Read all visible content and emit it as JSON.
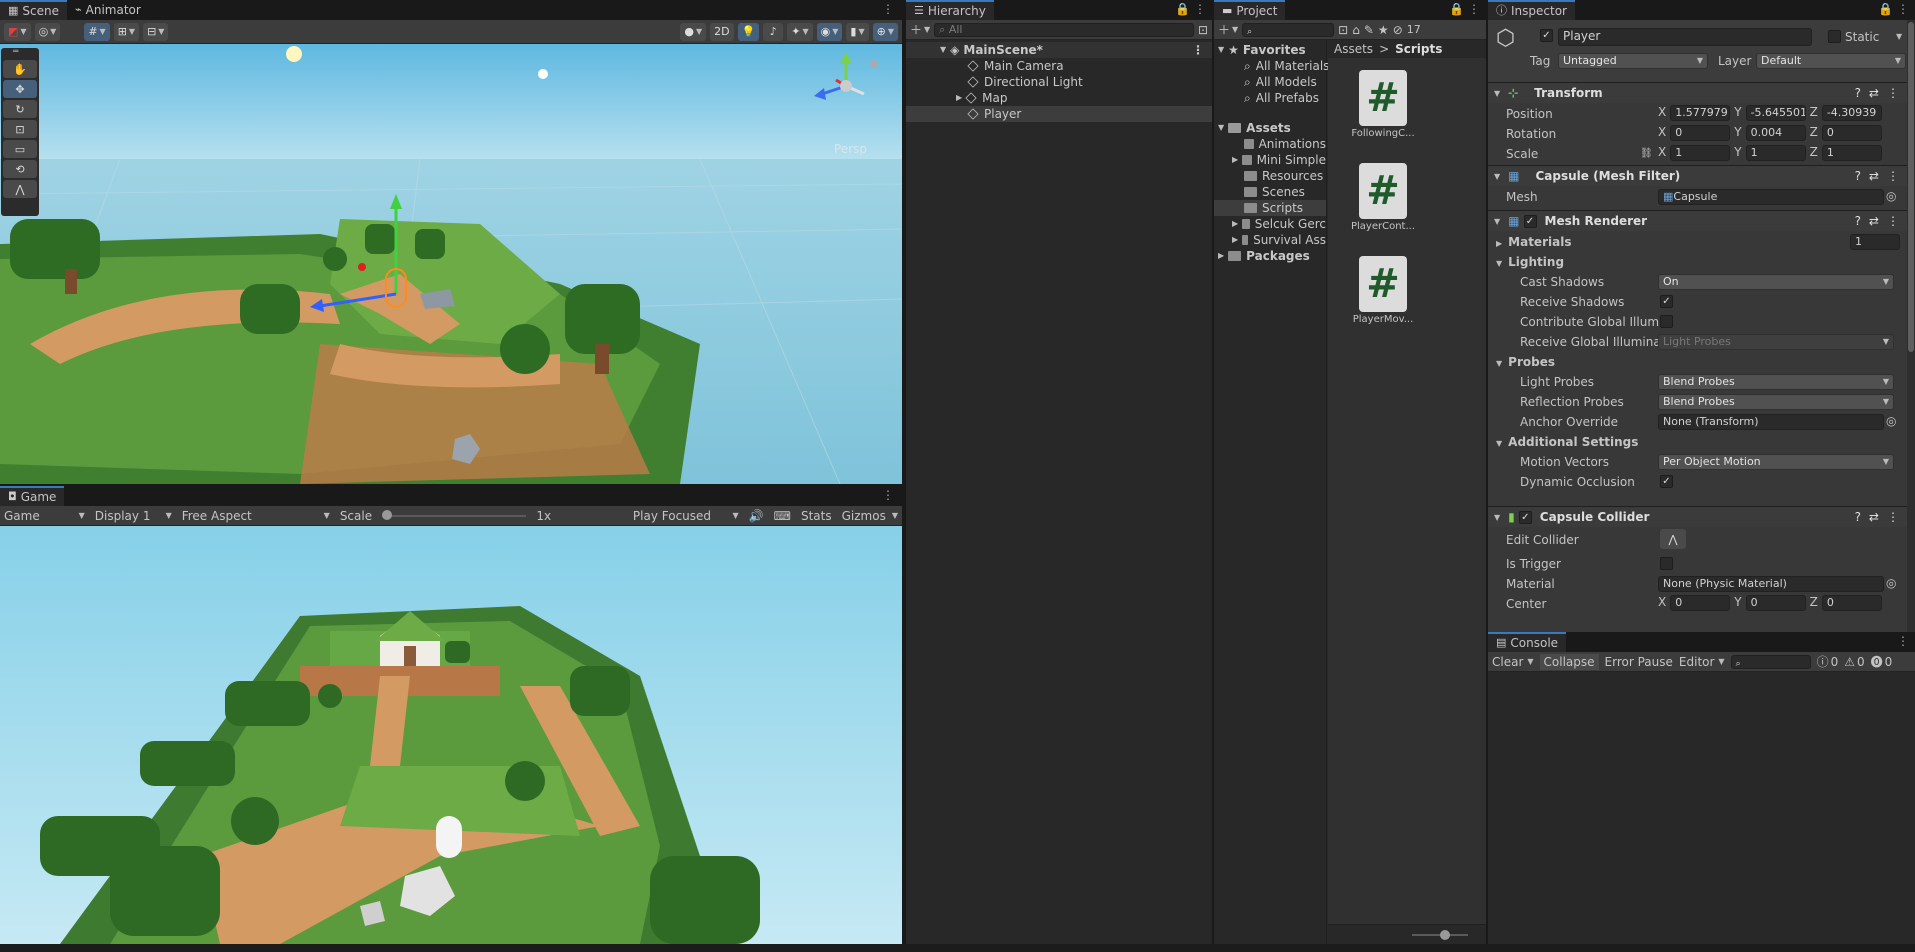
{
  "scene_tabs": [
    {
      "label": "Scene"
    },
    {
      "label": "Animator"
    }
  ],
  "scene_toolbar": {
    "btn_2d": "2D",
    "persp_label": "Persp"
  },
  "game": {
    "tab": "Game",
    "mode": "Game",
    "display": "Display 1",
    "aspect": "Free Aspect",
    "scale_label": "Scale",
    "scale_value": "1x",
    "play_mode": "Play Focused",
    "stats": "Stats",
    "gizmos": "Gizmos"
  },
  "hierarchy": {
    "tab": "Hierarchy",
    "search_placeholder": "All",
    "scene": "MainScene*",
    "items": [
      {
        "label": "Main Camera"
      },
      {
        "label": "Directional Light"
      },
      {
        "label": "Map"
      },
      {
        "label": "Player"
      }
    ]
  },
  "project": {
    "tab": "Project",
    "hidden_count": "17",
    "favorites": "Favorites",
    "fav_items": [
      {
        "label": "All Materials"
      },
      {
        "label": "All Models"
      },
      {
        "label": "All Prefabs"
      }
    ],
    "assets": "Assets",
    "asset_items": [
      {
        "label": "Animations"
      },
      {
        "label": "Mini Simple"
      },
      {
        "label": "Resources"
      },
      {
        "label": "Scenes"
      },
      {
        "label": "Scripts"
      },
      {
        "label": "Selcuk Gerc"
      },
      {
        "label": "Survival Ass"
      }
    ],
    "packages": "Packages",
    "breadcrumb_root": "Assets",
    "breadcrumb_sep": ">",
    "breadcrumb_current": "Scripts",
    "files": [
      {
        "label": "FollowingC..."
      },
      {
        "label": "PlayerCont..."
      },
      {
        "label": "PlayerMov..."
      }
    ]
  },
  "inspector": {
    "tab": "Inspector",
    "name": "Player",
    "static": "Static",
    "tag_label": "Tag",
    "tag": "Untagged",
    "layer_label": "Layer",
    "layer": "Default",
    "transform": {
      "title": "Transform",
      "position": "Position",
      "rotation": "Rotation",
      "scale": "Scale",
      "x": "X",
      "y": "Y",
      "z": "Z",
      "pos": [
        "1.577979",
        "-5.645501",
        "-4.30939"
      ],
      "rot": [
        "0",
        "0.004",
        "0"
      ],
      "scl": [
        "1",
        "1",
        "1"
      ]
    },
    "mesh_filter": {
      "title": "Capsule (Mesh Filter)",
      "mesh_label": "Mesh",
      "mesh": "Capsule"
    },
    "mesh_renderer": {
      "title": "Mesh Renderer",
      "materials": "Materials",
      "materials_count": "1",
      "lighting": "Lighting",
      "cast_shadows": "Cast Shadows",
      "cast_shadows_val": "On",
      "receive_shadows": "Receive Shadows",
      "contribute_gi": "Contribute Global Illumin",
      "receive_gi": "Receive Global Illuminati",
      "receive_gi_val": "Light Probes",
      "probes": "Probes",
      "light_probes": "Light Probes",
      "light_probes_val": "Blend Probes",
      "reflection_probes": "Reflection Probes",
      "reflection_probes_val": "Blend Probes",
      "anchor_override": "Anchor Override",
      "anchor_override_val": "None (Transform)",
      "additional": "Additional Settings",
      "motion_vectors": "Motion Vectors",
      "motion_vectors_val": "Per Object Motion",
      "dynamic_occlusion": "Dynamic Occlusion"
    },
    "collider": {
      "title": "Capsule Collider",
      "edit_collider": "Edit Collider",
      "is_trigger": "Is Trigger",
      "material": "Material",
      "material_val": "None (Physic Material)",
      "center": "Center",
      "center_vals": [
        "0",
        "0",
        "0"
      ]
    }
  },
  "console": {
    "tab": "Console",
    "clear": "Clear",
    "collapse": "Collapse",
    "error_pause": "Error Pause",
    "editor": "Editor",
    "logs": "0",
    "warnings": "0",
    "errors": "0"
  },
  "colors": {
    "accent": "#3a79bb",
    "selection": "#2c5d87",
    "panel": "#282828",
    "sky": "#8dd1e6",
    "grass": "#5b9a3d",
    "dirt": "#d49a63"
  }
}
